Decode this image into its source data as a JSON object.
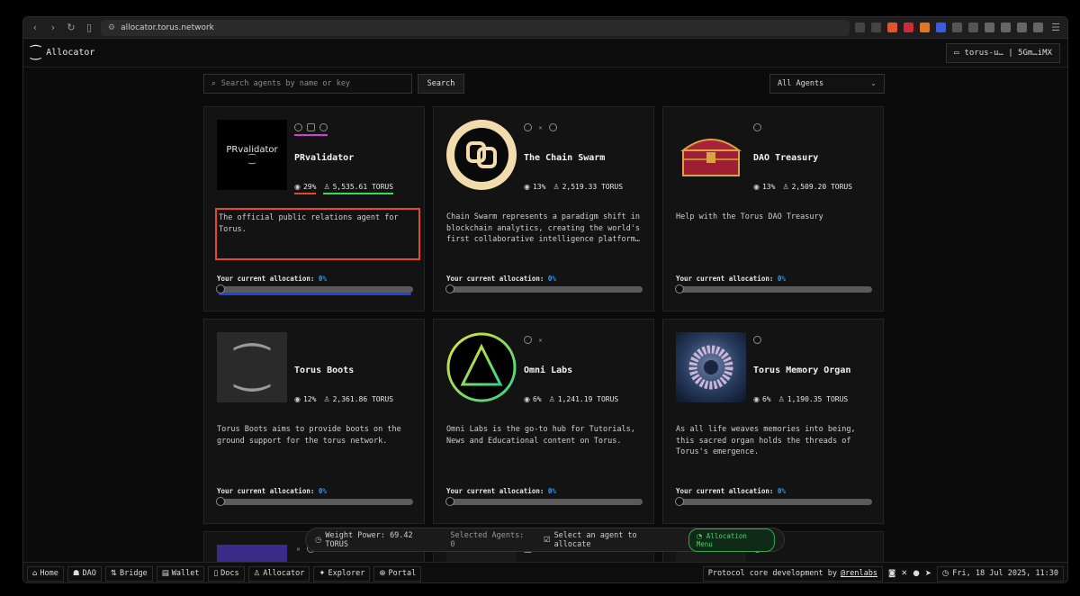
{
  "browser": {
    "url": "allocator.torus.network"
  },
  "app": {
    "logo": "⁐",
    "title": "Allocator",
    "wallet": "torus-u… | 5Gm…iMX"
  },
  "search": {
    "placeholder": "Search agents by name or key",
    "button": "Search",
    "filter": "All Agents"
  },
  "cards": [
    {
      "name": "PRvalidator",
      "thumb_text": "PRvalidator",
      "weight": "29%",
      "stake": "5,535.61 TORUS",
      "desc": "The official public relations agent for Torus.",
      "alloc_label": "Your current allocation:",
      "alloc_pct": "0%"
    },
    {
      "name": "The Chain Swarm",
      "weight": "13%",
      "stake": "2,519.33 TORUS",
      "desc": "Chain Swarm represents a paradigm shift in blockchain analytics, creating the world's first collaborative intelligence platform…",
      "alloc_label": "Your current allocation:",
      "alloc_pct": "0%"
    },
    {
      "name": "DAO Treasury",
      "weight": "13%",
      "stake": "2,509.20 TORUS",
      "desc": "Help with the Torus DAO Treasury",
      "alloc_label": "Your current allocation:",
      "alloc_pct": "0%"
    },
    {
      "name": "Torus Boots",
      "weight": "12%",
      "stake": "2,361.86 TORUS",
      "desc": "Torus Boots aims to provide boots on the ground support for the torus network.",
      "alloc_label": "Your current allocation:",
      "alloc_pct": "0%"
    },
    {
      "name": "Omni Labs",
      "weight": "6%",
      "stake": "1,241.19 TORUS",
      "desc": "Omni Labs is the go-to hub for Tutorials, News and Educational content on Torus.",
      "alloc_label": "Your current allocation:",
      "alloc_pct": "0%"
    },
    {
      "name": "Torus Memory Organ",
      "weight": "6%",
      "stake": "1,190.35 TORUS",
      "desc": "As all life weaves memories into being, this sacred organ holds the threads of Torus's emergence.",
      "alloc_label": "Your current allocation:",
      "alloc_pct": "0%"
    }
  ],
  "widget": {
    "weight_power": "Weight Power: 69.42 TORUS",
    "selected": "Selected Agents: 0",
    "hint": "Select an agent to allocate",
    "menu": "Allocation Menu"
  },
  "footer": {
    "links": [
      "Home",
      "DAO",
      "Bridge",
      "Wallet",
      "Docs",
      "Allocator",
      "Explorer",
      "Portal"
    ],
    "credit": "Protocol core development by",
    "credit_link": "@renlabs",
    "datetime": "Fri, 18 Jul 2025, 11:30"
  },
  "colors": {
    "accent_blue": "#2f9bff",
    "highlight_red": "#e5492c",
    "highlight_green": "#36e04b",
    "highlight_magenta": "#d83bd8",
    "highlight_navy": "#1f44e0"
  }
}
